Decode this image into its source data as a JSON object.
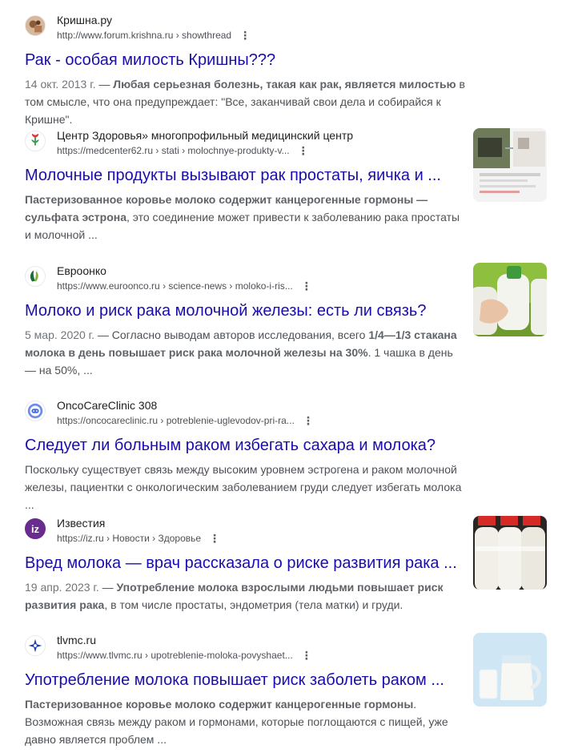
{
  "results": [
    {
      "site": "Кришна.ру",
      "url": "http://www.forum.krishna.ru › showthread",
      "title": "Рак - особая милость Кришны???",
      "date": "14 окт. 2013 г.",
      "dash": " — ",
      "bold1": "Любая серьезная болезнь, такая как рак, является милостью",
      "text1": " в том смысле, что она предупреждает: \"Все, заканчивай свои дела и собирайся к Кришне\"."
    },
    {
      "site": "Центр Здоровья» многопрофильный медицинский центр",
      "url": "https://medcenter62.ru › stati › molochnye-produkty-v...",
      "title": "Молочные продукты вызывают рак простаты, яичка и ...",
      "bold1": "Пастеризованное коровье молоко содержит канцерогенные гормоны — сульфата эстрона",
      "text1": ", это соединение может привести к заболеванию рака простаты и молочной ..."
    },
    {
      "site": "Евроонко",
      "url": "https://www.euroonco.ru › science-news › moloko-i-ris...",
      "title": "Молоко и риск рака молочной железы: есть ли связь?",
      "date": "5 мар. 2020 г.",
      "text0": " — Согласно выводам авторов исследования, всего ",
      "bold1": "1/4—1/3 стакана молока в день повышает риск рака молочной железы на 30%",
      "text1": ". 1 чашка в день — на 50%, ..."
    },
    {
      "site": "OncoCareClinic 308",
      "url": "https://oncocareclinic.ru › potreblenie-uglevodov-pri-ra...",
      "title": "Следует ли больным раком избегать сахара и молока?",
      "text1": "Поскольку существует связь между высоким уровнем эстрогена и раком молочной железы, пациентки с онкологическим заболеванием груди следует избегать молока ..."
    },
    {
      "site": "Известия",
      "url": "https://iz.ru › Новости › Здоровье",
      "title": "Вред молока — врач рассказала о риске развития рака ...",
      "date": "19 апр. 2023 г.",
      "dash": " — ",
      "bold1": "Употребление молока взрослыми людьми повышает риск развития рака",
      "text1": ", в том числе простаты, эндометрия (тела матки) и груди."
    },
    {
      "site": "tlvmc.ru",
      "url": "https://www.tlvmc.ru › upotreblenie-moloka-povyshaet...",
      "title": "Употребление молока повышает риск заболеть раком ...",
      "bold1": "Пастеризованное коровье молоко содержит канцерогенные гормоны",
      "text1": ". Возможная связь между раком и гормонами, которые поглощаются с пищей, уже давно является проблем ..."
    }
  ],
  "icons": {
    "more": "⋮",
    "izvestia": "iz"
  },
  "colors": {
    "title_link": "#1a0dab",
    "snippet": "#4d5156",
    "url": "#4d5156"
  }
}
